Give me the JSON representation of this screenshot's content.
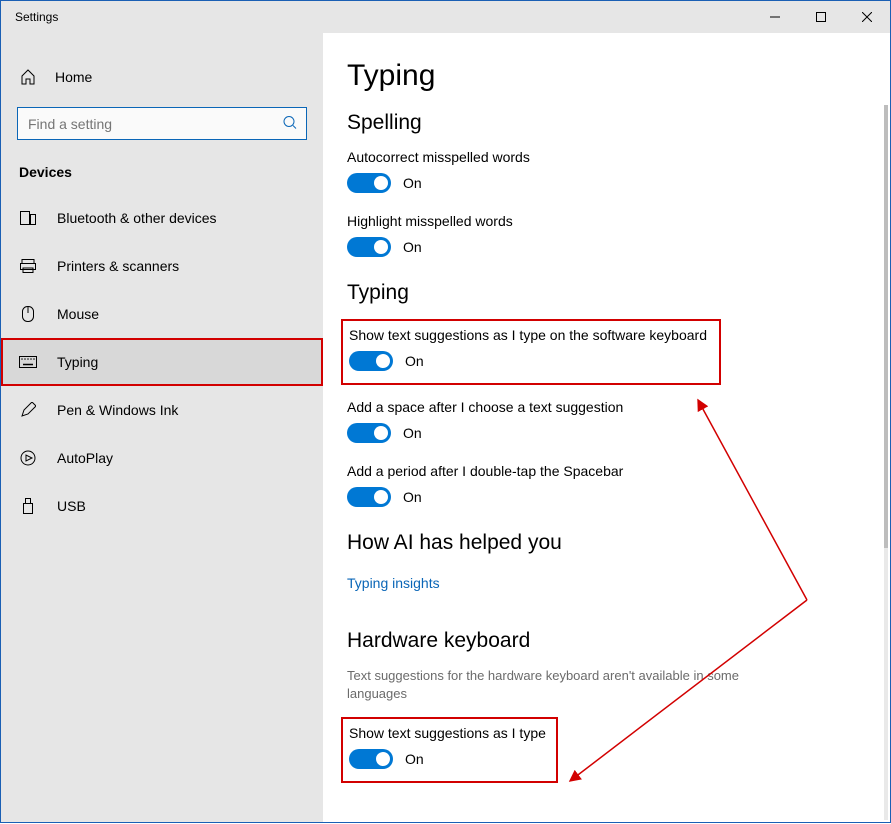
{
  "window": {
    "title": "Settings"
  },
  "sidebar": {
    "home": "Home",
    "search_placeholder": "Find a setting",
    "section": "Devices",
    "items": [
      {
        "label": "Bluetooth & other devices"
      },
      {
        "label": "Printers & scanners"
      },
      {
        "label": "Mouse"
      },
      {
        "label": "Typing"
      },
      {
        "label": "Pen & Windows Ink"
      },
      {
        "label": "AutoPlay"
      },
      {
        "label": "USB"
      }
    ]
  },
  "page": {
    "title": "Typing",
    "toggle_on": "On",
    "spelling": {
      "heading": "Spelling",
      "autocorrect": "Autocorrect misspelled words",
      "highlight": "Highlight misspelled words"
    },
    "typing": {
      "heading": "Typing",
      "suggest_sw": "Show text suggestions as I type on the software keyboard",
      "space_after": "Add a space after I choose a text suggestion",
      "period_dbltap": "Add a period after I double-tap the Spacebar"
    },
    "ai": {
      "heading": "How AI has helped you",
      "link": "Typing insights"
    },
    "hw": {
      "heading": "Hardware keyboard",
      "sub": "Text suggestions for the hardware keyboard aren't available in some languages",
      "suggest_hw": "Show text suggestions as I type"
    }
  }
}
